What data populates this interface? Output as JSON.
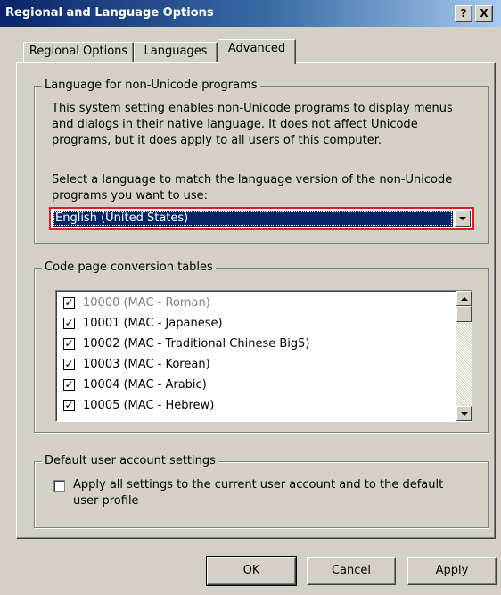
{
  "window": {
    "title": "Regional and Language Options",
    "help_button": "?",
    "close_button": "X"
  },
  "tabs": [
    {
      "label": "Regional Options",
      "active": false
    },
    {
      "label": "Languages",
      "active": false
    },
    {
      "label": "Advanced",
      "active": true
    }
  ],
  "non_unicode": {
    "legend": "Language for non-Unicode programs",
    "description_lines": [
      "This system setting enables non-Unicode programs to display menus",
      "and dialogs in their native language. It does not affect Unicode",
      "programs, but it does apply to all users of this computer."
    ],
    "select_prompt_lines": [
      "Select a language to match the language version of the non-Unicode",
      "programs you want to use:"
    ],
    "selected_language": "English (United States)"
  },
  "code_page": {
    "legend": "Code page conversion tables",
    "items": [
      {
        "label": "10000 (MAC - Roman)",
        "checked": true,
        "disabled": true
      },
      {
        "label": "10001 (MAC - Japanese)",
        "checked": true,
        "disabled": false
      },
      {
        "label": "10002 (MAC - Traditional Chinese Big5)",
        "checked": true,
        "disabled": false
      },
      {
        "label": "10003 (MAC - Korean)",
        "checked": true,
        "disabled": false
      },
      {
        "label": "10004 (MAC - Arabic)",
        "checked": true,
        "disabled": false
      },
      {
        "label": "10005 (MAC - Hebrew)",
        "checked": true,
        "disabled": false
      }
    ],
    "check_glyph": "✓"
  },
  "default_user": {
    "legend": "Default user account settings",
    "checkbox_lines": [
      "Apply all settings to the current user account and to the default",
      "user profile"
    ],
    "checked": false
  },
  "buttons": {
    "ok": "OK",
    "cancel": "Cancel",
    "apply": "Apply"
  }
}
